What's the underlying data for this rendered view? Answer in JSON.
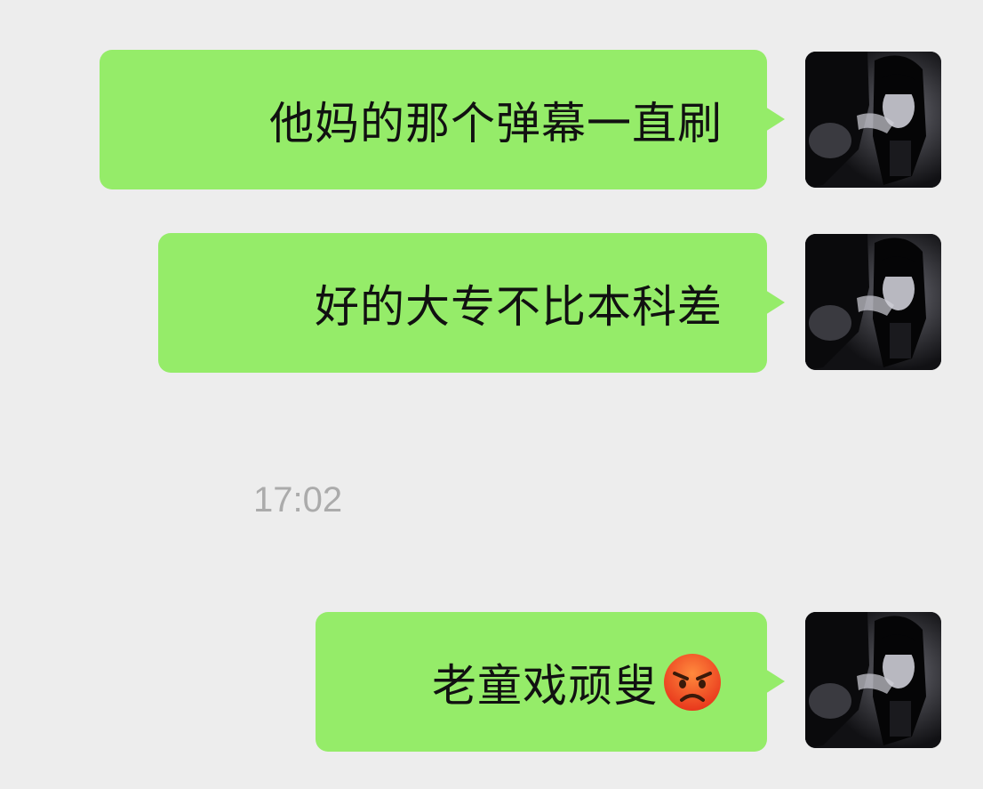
{
  "chat": {
    "messages": [
      {
        "text": "他妈的那个弹幕一直刷",
        "side": "right",
        "avatar_icon": "user-avatar-icon"
      },
      {
        "text": "好的大专不比本科差",
        "side": "right",
        "avatar_icon": "user-avatar-icon"
      },
      {
        "text": "老童戏顽叟",
        "side": "right",
        "avatar_icon": "user-avatar-icon",
        "emoji": "angry-face-emoji"
      }
    ],
    "timestamp": "17:02"
  },
  "colors": {
    "background": "#ededed",
    "bubble": "#95ec69",
    "timestamp": "#ababab",
    "text": "#111111"
  }
}
